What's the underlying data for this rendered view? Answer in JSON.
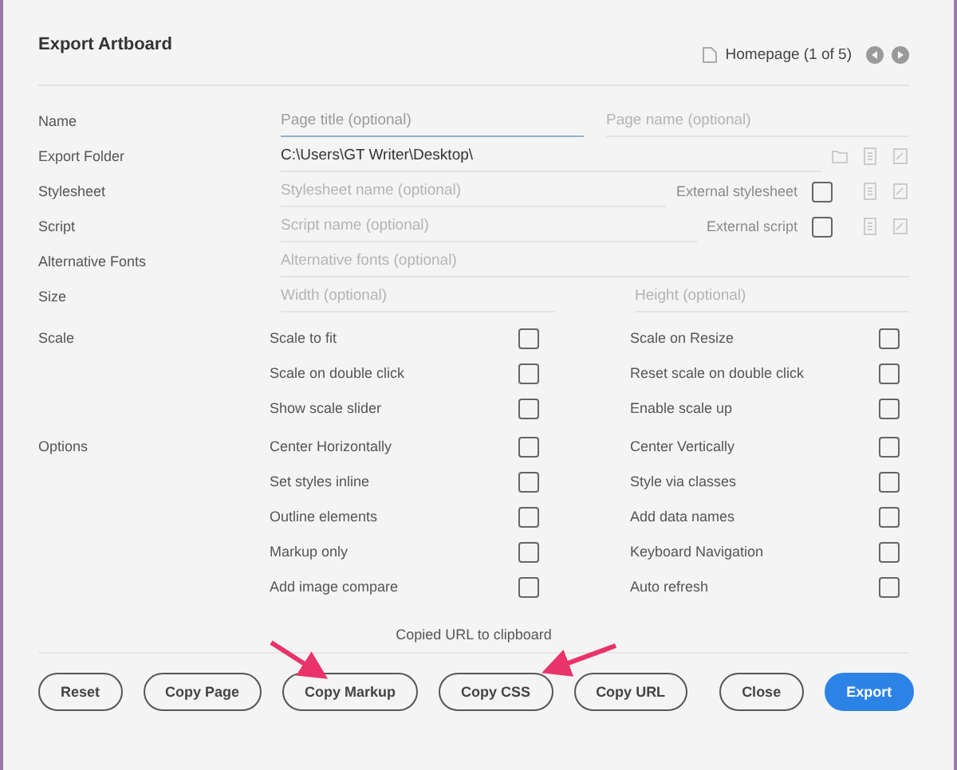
{
  "dialog": {
    "title": "Export Artboard",
    "page": "Homepage (1 of 5)"
  },
  "form_rows": [
    {
      "label": "Name",
      "kind": "double",
      "fields": [
        {
          "placeholder": "Page title (optional)",
          "focused": true
        },
        {
          "placeholder": "Page name (optional)",
          "focused": false
        }
      ]
    },
    {
      "label": "Export Folder",
      "kind": "folder",
      "fields": [
        {
          "value": "C:\\Users\\GT Writer\\Desktop\\",
          "focused": false
        }
      ]
    },
    {
      "label": "Stylesheet",
      "kind": "external",
      "fields": [
        {
          "placeholder": "Stylesheet name (optional)",
          "focused": false
        }
      ],
      "option": {
        "label": "External stylesheet",
        "checked": false
      }
    },
    {
      "label": "Script",
      "kind": "external",
      "fields": [
        {
          "placeholder": "Script name (optional)",
          "focused": false
        }
      ],
      "option": {
        "label": "External script",
        "checked": false
      }
    },
    {
      "label": "Alternative Fonts",
      "kind": "single",
      "fields": [
        {
          "placeholder": "Alternative fonts (optional)",
          "focused": false
        }
      ]
    },
    {
      "label": "Size",
      "kind": "double",
      "fields": [
        {
          "placeholder": "Width (optional)",
          "focused": false
        },
        {
          "placeholder": "Height (optional)",
          "focused": false
        }
      ]
    }
  ],
  "option_groups": [
    {
      "label": "Scale",
      "rows": [
        [
          {
            "label": "Scale to fit",
            "checked": false
          },
          {
            "label": "Scale on Resize",
            "checked": false
          }
        ],
        [
          {
            "label": "Scale on double click",
            "checked": false
          },
          {
            "label": "Reset scale on double click",
            "checked": false
          }
        ],
        [
          {
            "label": "Show scale slider",
            "checked": false
          },
          {
            "label": "Enable scale up",
            "checked": false
          }
        ]
      ]
    },
    {
      "label": "Options",
      "rows": [
        [
          {
            "label": "Center Horizontally",
            "checked": false
          },
          {
            "label": "Center Vertically",
            "checked": false
          }
        ],
        [
          {
            "label": "Set styles inline",
            "checked": false
          },
          {
            "label": "Style via classes",
            "checked": false
          }
        ],
        [
          {
            "label": "Outline elements",
            "checked": false
          },
          {
            "label": "Add data names",
            "checked": false
          }
        ],
        [
          {
            "label": "Markup only",
            "checked": false
          },
          {
            "label": "Keyboard Navigation",
            "checked": false
          }
        ],
        [
          {
            "label": "Add image compare",
            "checked": false
          },
          {
            "label": "Auto refresh",
            "checked": false
          }
        ]
      ]
    }
  ],
  "status": "Copied URL to clipboard",
  "buttons": [
    {
      "label": "Reset",
      "kind": "outline"
    },
    {
      "label": "Copy Page",
      "kind": "outline"
    },
    {
      "label": "Copy Markup",
      "kind": "outline"
    },
    {
      "label": "Copy CSS",
      "kind": "outline"
    },
    {
      "label": "Copy URL",
      "kind": "outline"
    },
    {
      "label": "Close",
      "kind": "outline"
    },
    {
      "label": "Export",
      "kind": "primary"
    }
  ]
}
